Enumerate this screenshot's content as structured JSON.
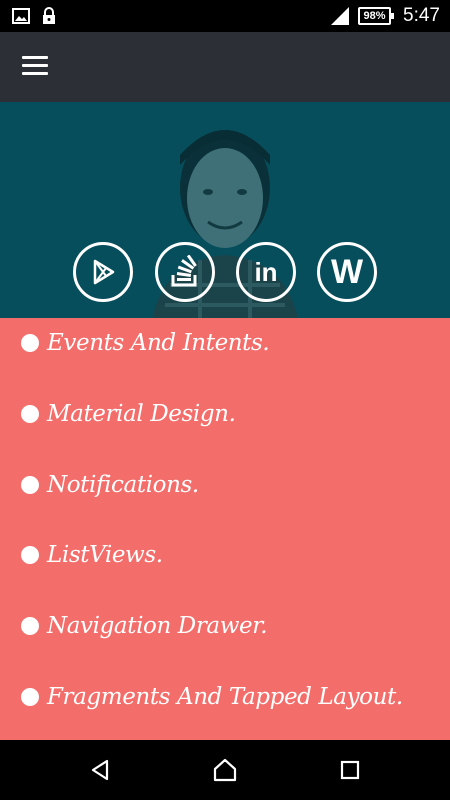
{
  "status_bar": {
    "icons": [
      "image-icon",
      "lock-icon",
      "signal-icon"
    ],
    "battery_percent": "98%",
    "time": "5:47"
  },
  "app_bar": {
    "menu_icon": "hamburger-menu-icon"
  },
  "profile": {
    "social_links": [
      {
        "icon": "google-play-icon"
      },
      {
        "icon": "stack-overflow-icon"
      },
      {
        "icon": "linkedin-icon",
        "label": "in"
      },
      {
        "icon": "wordpress-icon",
        "label": "W"
      }
    ]
  },
  "topics": [
    {
      "label": "Events And Intents."
    },
    {
      "label": "Material Design."
    },
    {
      "label": "Notifications."
    },
    {
      "label": "ListViews."
    },
    {
      "label": "Navigation Drawer."
    },
    {
      "label": "Fragments And Tapped Layout."
    }
  ],
  "nav_bar": {
    "buttons": [
      "back-icon",
      "home-icon",
      "recents-icon"
    ]
  },
  "colors": {
    "app_bar": "#2c2f36",
    "header": "#074e5c",
    "list_background": "#f36e6b",
    "text": "#ffffff"
  }
}
